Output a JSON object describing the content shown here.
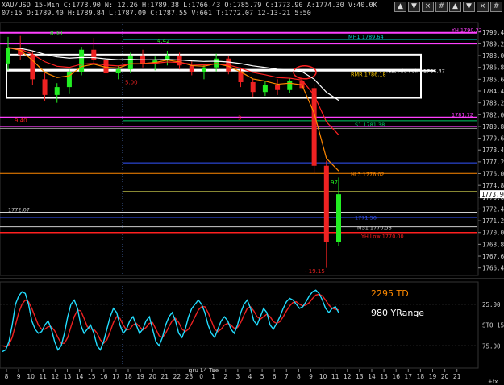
{
  "header": {
    "line1": "XAU/USD 15-Min C:1773.90 N: 12.26 H:1789.38 L:1766.43 O:1785.79 C:1773.90 A:1774.30 V:40.0K",
    "line2": "07:15 O:1789.40 H:1789.84 L:1787.09 C:1787.55 V:661 T:1772.07 12-13-21 5:50"
  },
  "toolbar_icons": [
    "up-icon",
    "down-icon",
    "close-icon",
    "grid-icon",
    "up-icon",
    "down-icon",
    "close-icon",
    "grid-icon"
  ],
  "panes": {
    "price": {
      "yticks": [
        "1790.40",
        "1789.20",
        "1788.00",
        "1786.80",
        "1785.60",
        "1784.40",
        "1783.20",
        "1782.00",
        "1780.80",
        "1779.60",
        "1778.40",
        "1777.20",
        "1776.00",
        "1774.80",
        "1773.60",
        "1772.40",
        "1771.20",
        "1770.00",
        "1768.80",
        "1767.60",
        "1766.40"
      ],
      "current_price": "1773.90",
      "level_label_1772": "1772.07",
      "annotations": {
        "high_mark": "8.30",
        "mark_442": "4.42",
        "mark_500": "5.00",
        "mark_940": "9.40",
        "mark_3": "3",
        "mark_500b": "5.00",
        "low_mark": "- 19.15",
        "mark_97": "97"
      },
      "level_labels": {
        "yh": "YH 1790.32",
        "mh": "MH1 1789.64",
        "mid": "Yest Mid Point 1786.47",
        "rmr": "RMR 1786.18",
        "s1": "S1 1781.38",
        "hl3": "HL3 1776.02",
        "ms1": "MS1 1770.58",
        "ylow": "YH Low 1770.00",
        "mid_blue": "1771.56",
        "r1": "1781.72"
      }
    },
    "osc": {
      "label_td": "2295 TD",
      "label_yr": "980 YRange",
      "yticks": [
        "25.00",
        "STO 15",
        "75.00"
      ],
      "stoch_k": [
        82,
        80,
        70,
        50,
        25,
        15,
        10,
        12,
        25,
        45,
        55,
        60,
        58,
        50,
        45,
        55,
        70,
        80,
        75,
        60,
        40,
        25,
        20,
        30,
        50,
        60,
        55,
        50,
        60,
        75,
        80,
        70,
        55,
        40,
        30,
        35,
        50,
        60,
        55,
        45,
        40,
        50,
        60,
        55,
        45,
        40,
        55,
        70,
        75,
        65,
        50,
        40,
        35,
        45,
        60,
        65,
        55,
        40,
        30,
        25,
        20,
        25,
        35,
        50,
        60,
        65,
        55,
        45,
        40,
        45,
        55,
        60,
        50,
        35,
        25,
        20,
        30,
        45,
        50,
        40,
        30,
        35,
        50,
        55,
        48,
        40,
        30,
        22,
        18,
        20,
        25,
        30,
        28,
        22,
        15,
        10,
        8,
        12,
        20,
        30,
        35,
        30,
        28,
        35
      ],
      "stoch_d": [
        75,
        76,
        74,
        65,
        50,
        35,
        25,
        20,
        22,
        30,
        40,
        50,
        55,
        55,
        52,
        52,
        57,
        65,
        72,
        72,
        65,
        52,
        40,
        32,
        33,
        42,
        52,
        55,
        55,
        60,
        68,
        72,
        68,
        58,
        47,
        40,
        42,
        50,
        56,
        55,
        50,
        48,
        52,
        56,
        53,
        48,
        47,
        55,
        63,
        65,
        60,
        52,
        45,
        42,
        47,
        55,
        58,
        55,
        48,
        40,
        32,
        28,
        28,
        35,
        45,
        55,
        58,
        55,
        50,
        48,
        50,
        54,
        53,
        47,
        38,
        30,
        28,
        33,
        40,
        43,
        40,
        37,
        40,
        46,
        48,
        46,
        40,
        33,
        27,
        23,
        22,
        25,
        27,
        26,
        23,
        18,
        14,
        13,
        15,
        20,
        26,
        30,
        31,
        32
      ]
    }
  },
  "x_axis": {
    "ticks": [
      "8",
      "9",
      "10",
      "11",
      "12",
      "13",
      "14",
      "15",
      "16",
      "17",
      "18",
      "19",
      "20",
      "21",
      "22",
      "23",
      "0",
      "1",
      "2",
      "3",
      "4",
      "5",
      "6",
      "7",
      "8",
      "9",
      "10",
      "11",
      "12",
      "13",
      "14",
      "15",
      "16",
      "17",
      "18",
      "19",
      "20",
      "21"
    ],
    "date_label": "gru 14 Tue",
    "fit_label": "+fx"
  },
  "chart_data": [
    {
      "type": "candlestick",
      "title": "XAU/USD 15-Min",
      "x": [
        "8",
        "9",
        "10",
        "11",
        "12",
        "13",
        "14",
        "15",
        "16",
        "17",
        "18",
        "19",
        "20",
        "21",
        "22",
        "23",
        "0",
        "1",
        "2",
        "3",
        "4",
        "5",
        "6",
        "7",
        "8",
        "9",
        "10",
        "11"
      ],
      "ylim": [
        1765.8,
        1791.2
      ],
      "candles": [
        {
          "o": 1787.2,
          "h": 1789.9,
          "l": 1786.5,
          "c": 1788.8
        },
        {
          "o": 1788.8,
          "h": 1790.0,
          "l": 1787.6,
          "c": 1788.1
        },
        {
          "o": 1788.1,
          "h": 1788.5,
          "l": 1785.0,
          "c": 1785.6
        },
        {
          "o": 1785.6,
          "h": 1786.2,
          "l": 1783.4,
          "c": 1784.0
        },
        {
          "o": 1784.0,
          "h": 1785.2,
          "l": 1783.2,
          "c": 1784.8
        },
        {
          "o": 1784.8,
          "h": 1786.6,
          "l": 1784.1,
          "c": 1786.3
        },
        {
          "o": 1786.3,
          "h": 1788.9,
          "l": 1786.0,
          "c": 1788.6
        },
        {
          "o": 1788.6,
          "h": 1789.8,
          "l": 1787.2,
          "c": 1787.6
        },
        {
          "o": 1787.6,
          "h": 1788.4,
          "l": 1785.8,
          "c": 1786.2
        },
        {
          "o": 1786.2,
          "h": 1787.0,
          "l": 1785.6,
          "c": 1786.6
        },
        {
          "o": 1786.6,
          "h": 1788.3,
          "l": 1786.2,
          "c": 1788.0
        },
        {
          "o": 1788.0,
          "h": 1788.6,
          "l": 1786.8,
          "c": 1787.2
        },
        {
          "o": 1787.2,
          "h": 1787.9,
          "l": 1786.5,
          "c": 1787.5
        },
        {
          "o": 1787.5,
          "h": 1788.5,
          "l": 1787.0,
          "c": 1788.0
        },
        {
          "o": 1788.0,
          "h": 1788.3,
          "l": 1786.6,
          "c": 1787.0
        },
        {
          "o": 1787.0,
          "h": 1787.4,
          "l": 1786.0,
          "c": 1786.3
        },
        {
          "o": 1786.3,
          "h": 1787.1,
          "l": 1785.6,
          "c": 1786.8
        },
        {
          "o": 1786.8,
          "h": 1788.2,
          "l": 1786.4,
          "c": 1787.7
        },
        {
          "o": 1787.7,
          "h": 1788.0,
          "l": 1786.1,
          "c": 1786.4
        },
        {
          "o": 1786.4,
          "h": 1786.8,
          "l": 1784.8,
          "c": 1785.3
        },
        {
          "o": 1785.3,
          "h": 1785.6,
          "l": 1783.8,
          "c": 1784.3
        },
        {
          "o": 1784.3,
          "h": 1785.4,
          "l": 1783.9,
          "c": 1785.0
        },
        {
          "o": 1785.0,
          "h": 1785.6,
          "l": 1784.0,
          "c": 1784.5
        },
        {
          "o": 1784.5,
          "h": 1785.7,
          "l": 1784.2,
          "c": 1785.4
        },
        {
          "o": 1785.4,
          "h": 1785.8,
          "l": 1784.4,
          "c": 1784.7
        },
        {
          "o": 1784.7,
          "h": 1785.1,
          "l": 1776.0,
          "c": 1776.8
        },
        {
          "o": 1776.8,
          "h": 1777.3,
          "l": 1766.4,
          "c": 1769.0
        },
        {
          "o": 1769.0,
          "h": 1775.6,
          "l": 1768.6,
          "c": 1773.9
        }
      ]
    },
    {
      "type": "line",
      "title": "",
      "ylim": [
        0,
        100
      ],
      "series": [
        {
          "name": "STO 15 %K",
          "values": []
        },
        {
          "name": "STO 15 %D",
          "values": []
        }
      ]
    }
  ]
}
